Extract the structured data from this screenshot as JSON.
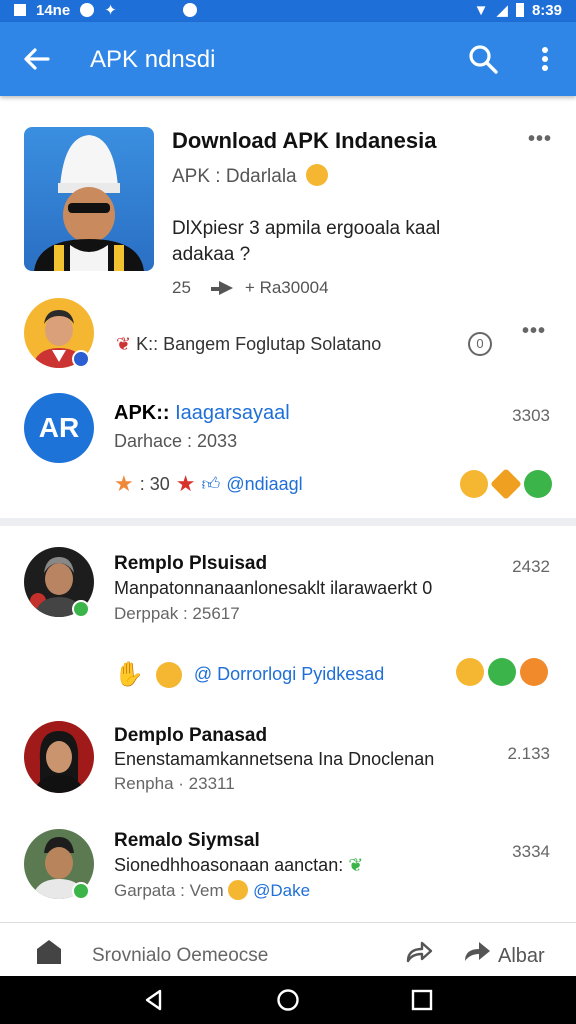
{
  "status_bar": {
    "left_text": "14ne",
    "time": "8:39"
  },
  "app_bar": {
    "title": "APK ndnsdi"
  },
  "hero": {
    "title": "Download APK Indanesia",
    "subtitle": "APK : Ddarlala",
    "description": "DlXpiesr 3 apmila ergooala kaal adakaa ?",
    "count": "25",
    "shares": "+ Ra30004"
  },
  "row2": {
    "text": "K:: Bangem Foglutap Solatano"
  },
  "apk_item": {
    "logo_text": "AR",
    "title_prefix": "APK::",
    "title_link": "Iaagarsayaal",
    "date": "Darhace : 2033",
    "meta_stars": ": 30",
    "meta_link": "@ndiaagl",
    "number": "3303"
  },
  "posts": [
    {
      "name": "Remplo Plsuisad",
      "body": "Manpatonnanaanlonesaklt ilarawaerkt 0",
      "sub": "Derppak : 25617",
      "number": "2432",
      "reaction_link": "@ Dorrorlogi Pyidkesad"
    },
    {
      "name": "Demplo Panasad",
      "body": "Enenstamamkannetsena Ina Dnoclenan",
      "sub": "Renpha · 23311",
      "number": "2.133"
    },
    {
      "name": "Remalo Siymsal",
      "body": "Sionedhhoasonaan aanctan:",
      "sub_prefix": "Garpata : Vem",
      "sub_link": "@Dake",
      "number": "3334"
    }
  ],
  "bottom_bar": {
    "input_text": "Srovnialo Oemeocse",
    "right_label": "Albar"
  },
  "colors": {
    "primary": "#2f86e6",
    "status": "#1f6fd8",
    "link": "#1f6fd8"
  }
}
